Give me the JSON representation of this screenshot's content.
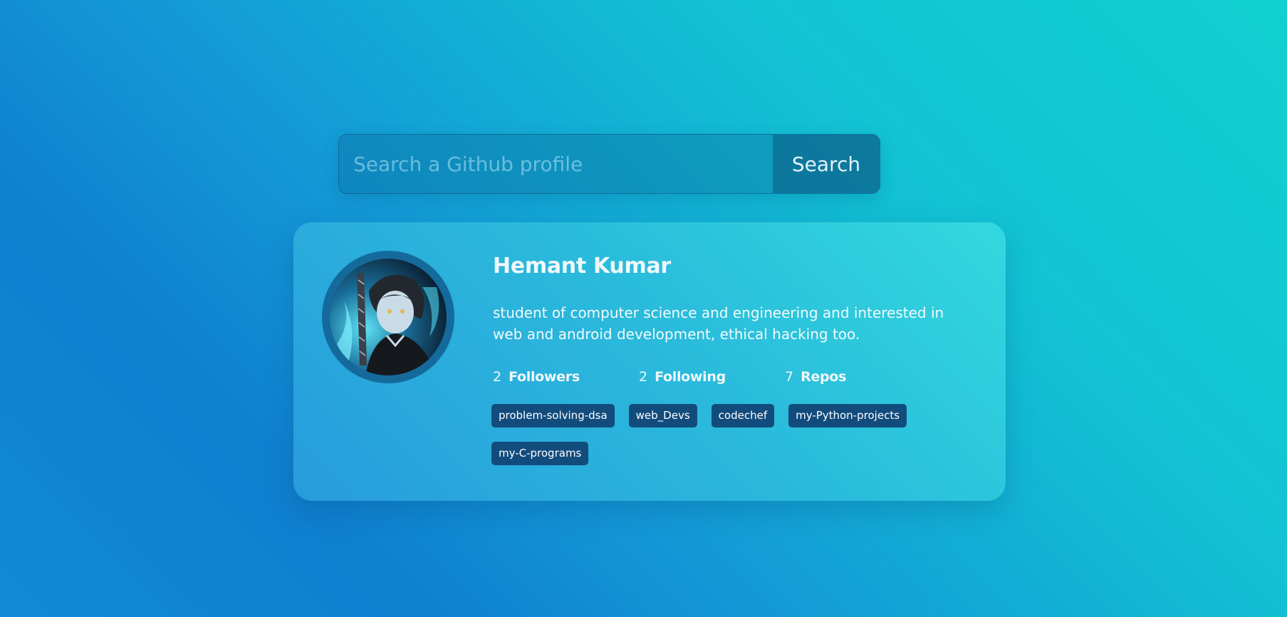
{
  "search": {
    "placeholder": "Search a Github profile",
    "value": "",
    "button_label": "Search"
  },
  "profile": {
    "name": "Hemant Kumar",
    "bio": "student of computer science and engineering and interested in web and android development, ethical hacking too.",
    "stats": [
      {
        "value": "2",
        "label": "Followers"
      },
      {
        "value": "2",
        "label": "Following"
      },
      {
        "value": "7",
        "label": "Repos"
      }
    ],
    "repos": [
      "problem-solving-dsa",
      "web_Devs",
      "codechef",
      "my-Python-projects",
      "my-C-programs"
    ]
  },
  "colors": {
    "repo_badge": "#124c7d",
    "avatar_ring": "#156a9c"
  }
}
